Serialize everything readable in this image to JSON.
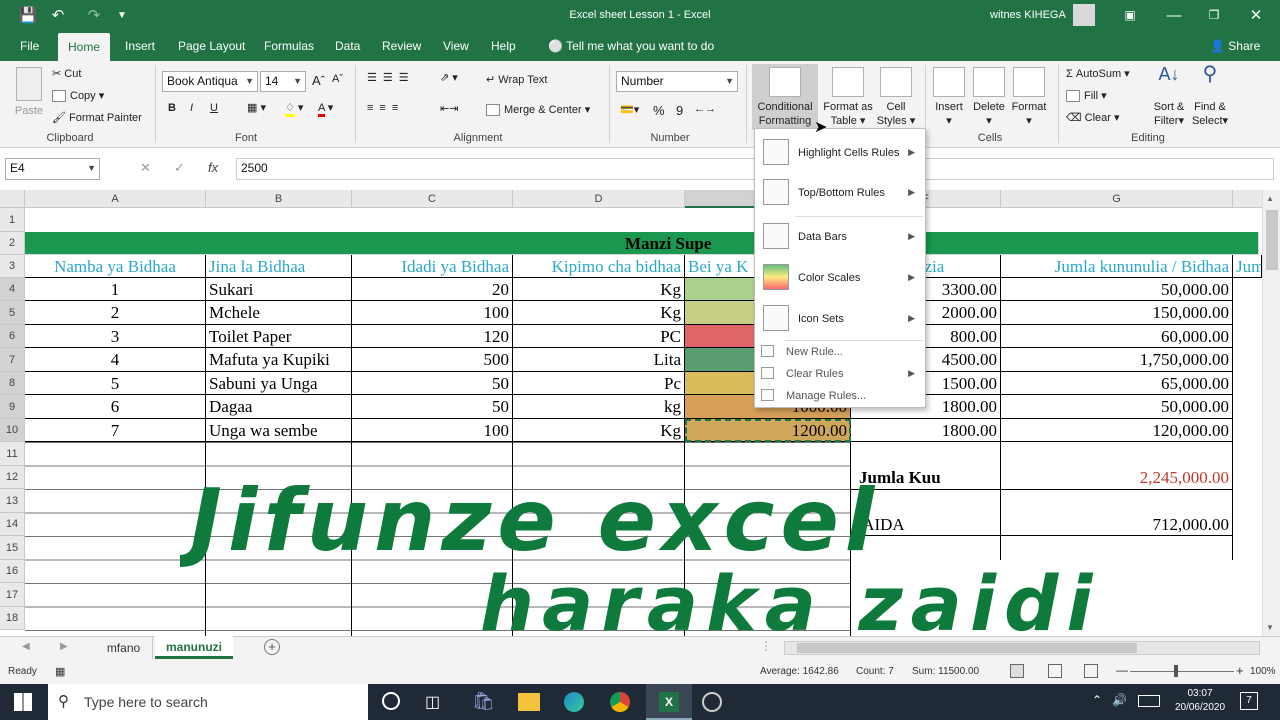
{
  "titlebar": {
    "doc_title": "Excel sheet Lesson 1  -  Excel",
    "user": "witnes KIHEGA"
  },
  "tabs": [
    "File",
    "Home",
    "Insert",
    "Page Layout",
    "Formulas",
    "Data",
    "Review",
    "View",
    "Help"
  ],
  "tell_me": "Tell me what you want to do",
  "share": "Share",
  "clipboard": {
    "paste": "Paste",
    "cut": "Cut",
    "copy": "Copy",
    "format_painter": "Format Painter",
    "label": "Clipboard"
  },
  "font": {
    "name": "Book Antiqua",
    "size": "14",
    "bold": "B",
    "italic": "I",
    "underline": "U",
    "label": "Font"
  },
  "alignment": {
    "wrap": "Wrap Text",
    "merge": "Merge & Center",
    "label": "Alignment"
  },
  "number": {
    "format": "Number",
    "percent": "%",
    "comma": "9",
    "label": "Number"
  },
  "styles": {
    "cond1": "Conditional",
    "cond2": "Formatting",
    "table1": "Format as",
    "table2": "Table",
    "cell1": "Cell",
    "cell2": "Styles"
  },
  "cells": {
    "insert": "Insert",
    "delete": "Delete",
    "format": "Format",
    "label": "Cells"
  },
  "editing": {
    "autosum": "AutoSum",
    "fill": "Fill",
    "clear": "Clear",
    "sort1": "Sort &",
    "sort2": "Filter",
    "find1": "Find &",
    "find2": "Select",
    "label": "Editing"
  },
  "formula_bar": {
    "namebox": "E4",
    "fx": "fx",
    "value": "2500"
  },
  "columns": [
    "A",
    "B",
    "C",
    "D",
    "E",
    "F",
    "G"
  ],
  "rows": [
    "1",
    "2",
    "3",
    "4",
    "5",
    "6",
    "7",
    "8",
    "9",
    "10",
    "11",
    "12",
    "13",
    "14",
    "15",
    "16",
    "17",
    "18"
  ],
  "sheet_title": "Manzi Supe",
  "headers": [
    "Namba ya Bidhaa",
    "Jina la Bidhaa",
    "Idadi ya Bidhaa",
    "Kipimo cha bidhaa",
    "Bei ya K",
    "uzia",
    "Jumla kununulia / Bidhaa",
    "Jum"
  ],
  "table": [
    {
      "n": "1",
      "name": "Sukari",
      "qty": "20",
      "unit": "Kg",
      "e": "",
      "f": "3300.00",
      "g": "50,000.00",
      "color": "#a9d08e"
    },
    {
      "n": "2",
      "name": "Mchele",
      "qty": "100",
      "unit": "Kg",
      "e": "",
      "f": "2000.00",
      "g": "150,000.00",
      "color": "#c9cf84"
    },
    {
      "n": "3",
      "name": "Toilet Paper",
      "qty": "120",
      "unit": "PC",
      "e": "",
      "f": "800.00",
      "g": "60,000.00",
      "color": "#e06666"
    },
    {
      "n": "4",
      "name": "Mafuta ya Kupiki",
      "qty": "500",
      "unit": "Lita",
      "e": "",
      "f": "4500.00",
      "g": "1,750,000.00",
      "color": "#5a9e6f"
    },
    {
      "n": "5",
      "name": "Sabuni ya Unga",
      "qty": "50",
      "unit": "Pc",
      "e": "",
      "f": "1500.00",
      "g": "65,000.00",
      "color": "#d9bc5c"
    },
    {
      "n": "6",
      "name": "Dagaa",
      "qty": "50",
      "unit": "kg",
      "e": "1000.00",
      "f": "1800.00",
      "g": "50,000.00",
      "color": "#d6a05a"
    },
    {
      "n": "7",
      "name": "Unga wa sembe",
      "qty": "100",
      "unit": "Kg",
      "e": "1200.00",
      "f": "1800.00",
      "g": "120,000.00",
      "color": "#cfa75a"
    }
  ],
  "jumla_kuu": "Jumla Kuu",
  "jumla_val": "2,245,000.00",
  "faida": "FAIDA",
  "faida_val": "712,000.00",
  "handwriting": {
    "line1": "Jifunze excel",
    "line2": "haraka zaidi"
  },
  "cf_menu": {
    "highlight": "Highlight Cells Rules",
    "topbottom": "Top/Bottom Rules",
    "databars": "Data Bars",
    "colorscales": "Color Scales",
    "iconsets": "Icon Sets",
    "newrule": "New Rule...",
    "clearrules": "Clear Rules",
    "managerules": "Manage Rules..."
  },
  "sheet_tabs": [
    "mfano",
    "manunuzi"
  ],
  "status": {
    "ready": "Ready",
    "average": "Average: 1642.86",
    "count": "Count: 7",
    "sum": "Sum: 11500.00",
    "zoom": "100%"
  },
  "taskbar": {
    "search": "Type here to search",
    "time": "03:07",
    "date": "20/06/2020",
    "notif": "7"
  },
  "colors": {
    "excel_green": "#217346",
    "header_blue": "#29a8c9",
    "title_row": "#1a9850",
    "red_total": "#c0392b"
  }
}
